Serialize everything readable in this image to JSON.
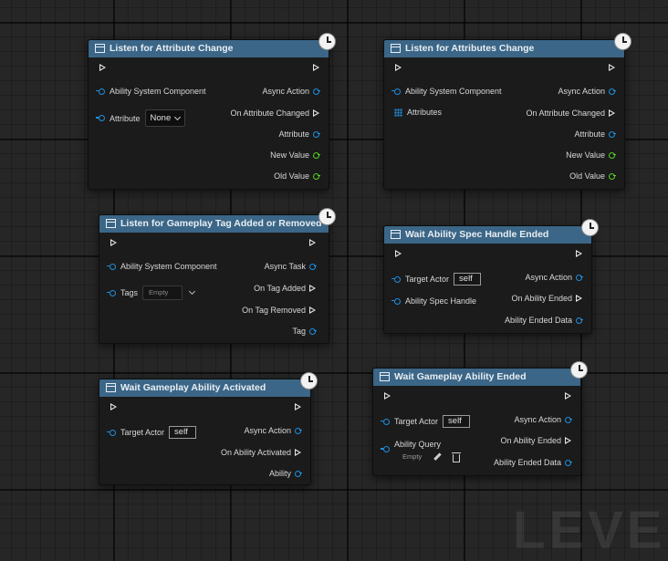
{
  "watermark": "LEVEL",
  "nodes": {
    "n1": {
      "title": "Listen for Attribute Change",
      "asc": "Ability System Component",
      "attribute_label": "Attribute",
      "attribute_value": "None",
      "async_action": "Async Action",
      "on_changed": "On Attribute Changed",
      "out_attribute": "Attribute",
      "new_value": "New Value",
      "old_value": "Old Value"
    },
    "n2": {
      "title": "Listen for Attributes Change",
      "asc": "Ability System Component",
      "attributes": "Attributes",
      "async_action": "Async Action",
      "on_changed": "On Attribute Changed",
      "out_attribute": "Attribute",
      "new_value": "New Value",
      "old_value": "Old Value"
    },
    "n3": {
      "title": "Listen for Gameplay Tag Added or Removed",
      "asc": "Ability System Component",
      "tags_label": "Tags",
      "tags_value": "Empty",
      "async_task": "Async Task",
      "on_tag_added": "On Tag Added",
      "on_tag_removed": "On Tag Removed",
      "tag": "Tag"
    },
    "n4": {
      "title": "Wait Ability Spec Handle Ended",
      "target_actor": "Target Actor",
      "target_value": "self",
      "spec_handle": "Ability Spec Handle",
      "async_action": "Async Action",
      "on_ability_ended": "On Ability Ended",
      "ended_data": "Ability Ended Data"
    },
    "n5": {
      "title": "Wait Gameplay Ability Activated",
      "target_actor": "Target Actor",
      "target_value": "self",
      "async_action": "Async Action",
      "on_activated": "On Ability Activated",
      "ability": "Ability"
    },
    "n6": {
      "title": "Wait Gameplay Ability Ended",
      "target_actor": "Target Actor",
      "target_value": "self",
      "ability_query": "Ability Query",
      "query_value": "Empty",
      "async_action": "Async Action",
      "on_ability_ended": "On Ability Ended",
      "ended_data": "Ability Ended Data"
    }
  }
}
